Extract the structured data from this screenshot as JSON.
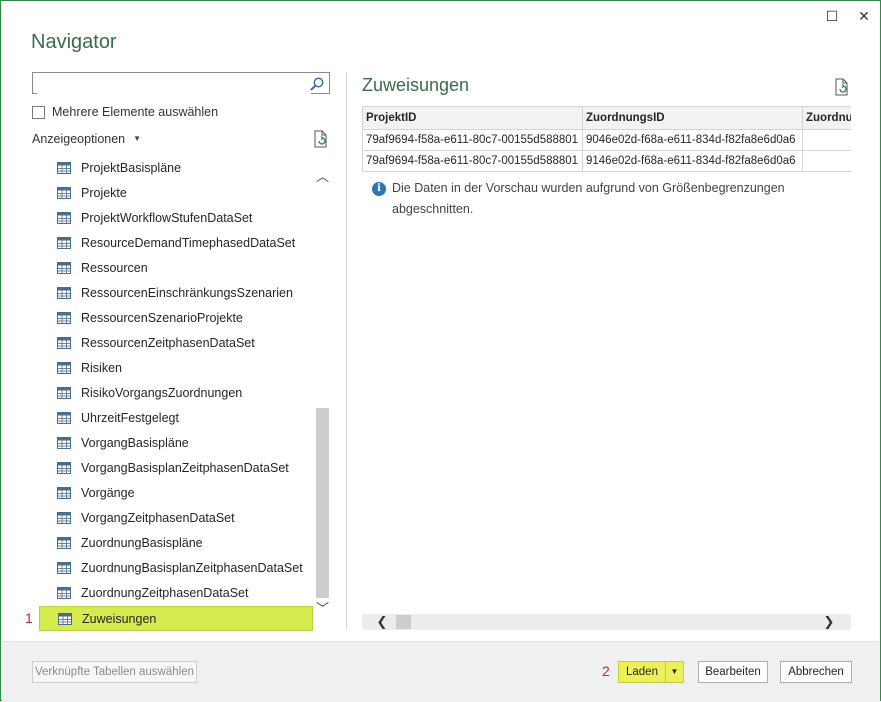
{
  "window": {
    "title": "Navigator",
    "maximize_glyph": "☐",
    "close_glyph": "✕"
  },
  "left": {
    "search": {
      "value": "",
      "placeholder": ""
    },
    "multi_select_label": "Mehrere Elemente auswählen",
    "multi_select_checked": false,
    "display_options_label": "Anzeigeoptionen",
    "items": [
      "ProjektBasispläne",
      "Projekte",
      "ProjektWorkflowStufenDataSet",
      "ResourceDemandTimephasedDataSet",
      "Ressourcen",
      "RessourcenEinschränkungsSzenarien",
      "RessourcenSzenarioProjekte",
      "RessourcenZeitphasenDataSet",
      "Risiken",
      "RisikoVorgangsZuordnungen",
      "UhrzeitFestgelegt",
      "VorgangBasispläne",
      "VorgangBasisplanZeitphasenDataSet",
      "Vorgänge",
      "VorgangZeitphasenDataSet",
      "ZuordnungBasispläne",
      "ZuordnungBasisplanZeitphasenDataSet",
      "ZuordnungZeitphasenDataSet",
      "Zuweisungen"
    ],
    "selected_item": "Zuweisungen",
    "marker_1": "1"
  },
  "preview": {
    "title": "Zuweisungen",
    "columns": [
      "ProjektID",
      "ZuordnungsID",
      "Zuordnun"
    ],
    "rows": [
      [
        "79af9694-f58a-e611-80c7-00155d588801",
        "9046e02d-f68a-e611-834d-f82fa8e6d0a6",
        ""
      ],
      [
        "79af9694-f58a-e611-80c7-00155d588801",
        "9146e02d-f68a-e611-834d-f82fa8e6d0a6",
        ""
      ]
    ],
    "info_text": "Die Daten in der Vorschau wurden aufgrund von Größenbegrenzungen abgeschnitten."
  },
  "footer": {
    "linked_tables_label": "Verknüpfte Tabellen auswählen",
    "marker_2": "2",
    "load_label": "Laden",
    "edit_label": "Bearbeiten",
    "cancel_label": "Abbrechen"
  },
  "colors": {
    "title_green": "#3b6b4e",
    "selection_yellow_green": "#d4ea4e",
    "load_highlight": "#ecf05a",
    "marker_red": "#c0283a",
    "info_blue": "#2e75b6"
  }
}
